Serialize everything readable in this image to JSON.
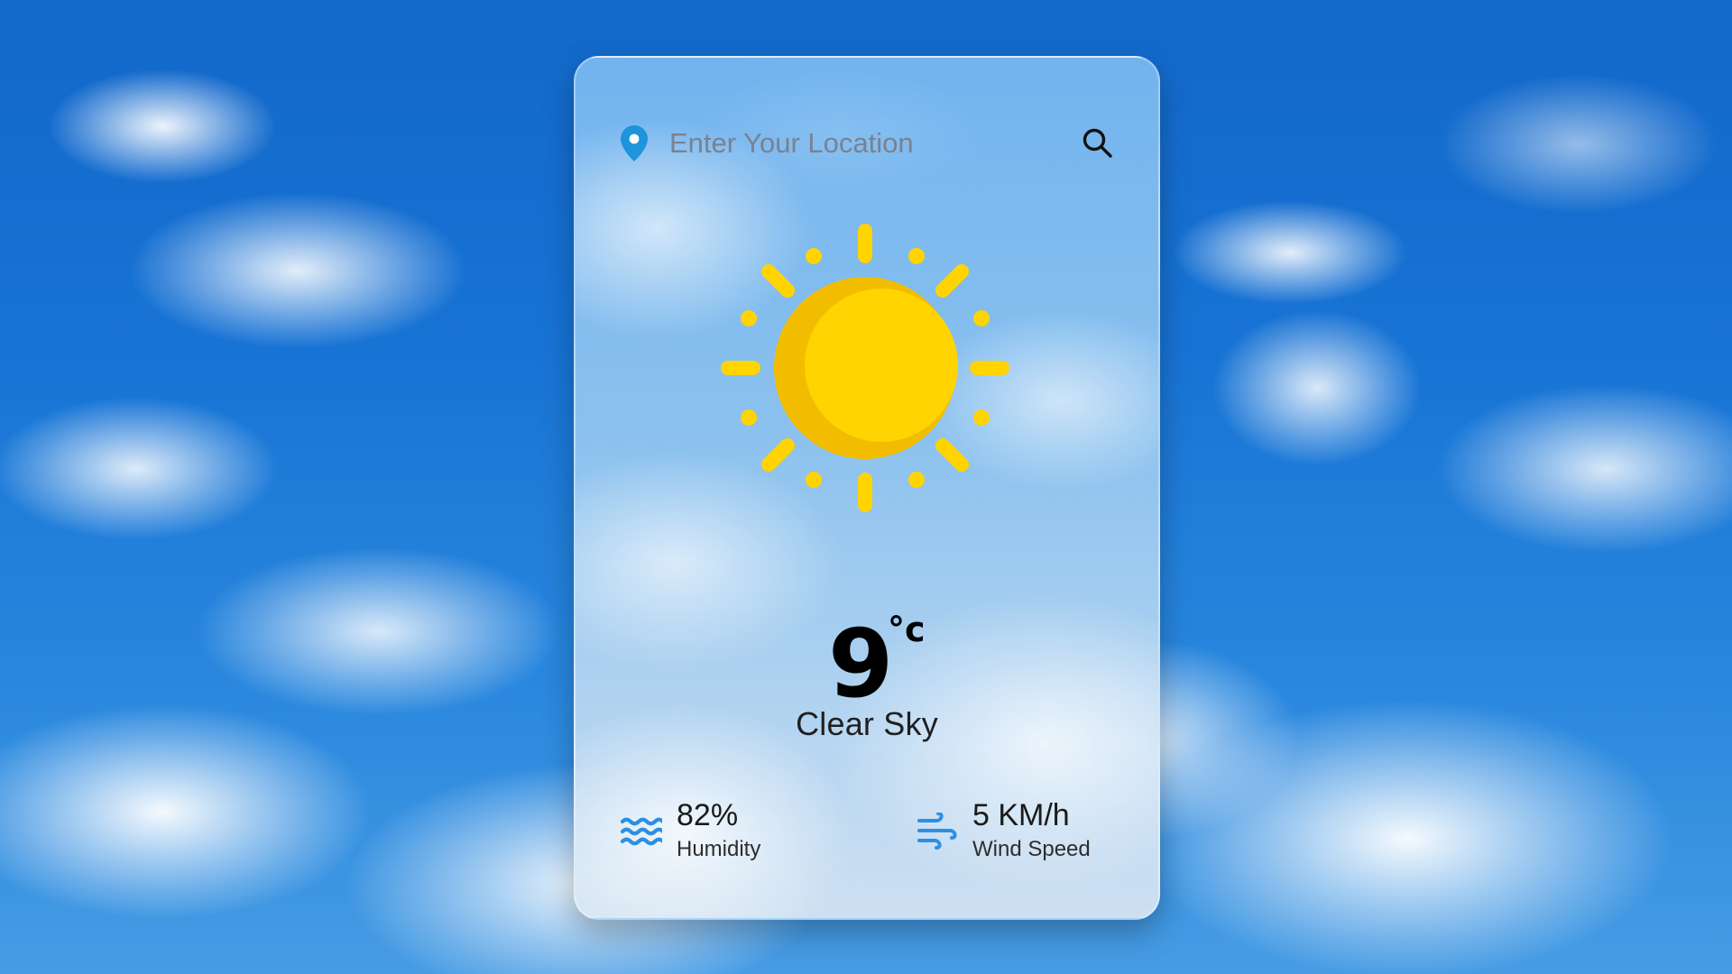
{
  "background": {
    "sky_color": "#1f6fc8"
  },
  "weather_card": {
    "search": {
      "placeholder": "Enter Your Location"
    },
    "icons": {
      "location": "location-pin-icon",
      "search": "search-icon",
      "weather": "sun-icon",
      "humidity": "humidity-icon",
      "wind": "wind-icon"
    },
    "temperature": {
      "value": "9",
      "unit": "°c"
    },
    "condition": "Clear Sky",
    "humidity": {
      "value": "82%",
      "label": "Humidity"
    },
    "wind": {
      "value": "5 KM/h",
      "label": "Wind Speed"
    },
    "colors": {
      "accent_blue": "#2d8fe3",
      "sun_yellow": "#ffd400",
      "sun_shadow": "#f2bd00"
    }
  }
}
